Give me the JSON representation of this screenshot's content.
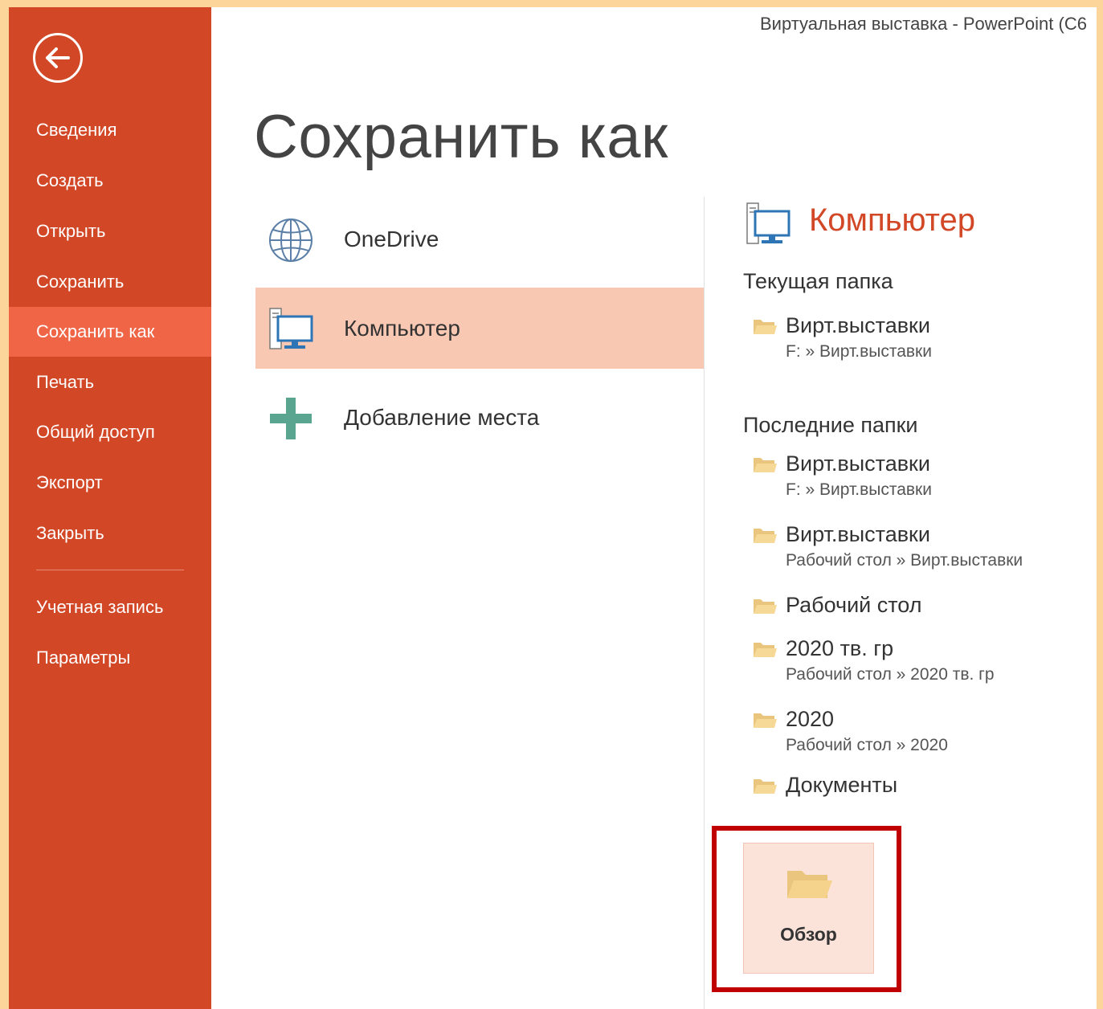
{
  "window_title": "Виртуальная выставка - PowerPoint (C6",
  "nav": {
    "back_icon": "back-arrow-icon",
    "items": [
      {
        "label": "Сведения"
      },
      {
        "label": "Создать"
      },
      {
        "label": "Открыть"
      },
      {
        "label": "Сохранить"
      },
      {
        "label": "Сохранить как",
        "active": true
      },
      {
        "label": "Печать"
      },
      {
        "label": "Общий доступ"
      },
      {
        "label": "Экспорт"
      },
      {
        "label": "Закрыть"
      },
      {
        "label": "Учетная запись"
      },
      {
        "label": "Параметры"
      }
    ]
  },
  "page_title": "Сохранить как",
  "locations": [
    {
      "label": "OneDrive",
      "icon": "globe-icon"
    },
    {
      "label": "Компьютер",
      "icon": "computer-icon",
      "active": true
    },
    {
      "label": "Добавление места",
      "icon": "plus-icon"
    }
  ],
  "right": {
    "heading": "Компьютер",
    "heading_icon": "computer-icon",
    "current_title": "Текущая папка",
    "current": [
      {
        "name": "Вирт.выставки",
        "path": "F: » Вирт.выставки"
      }
    ],
    "recent_title": "Последние папки",
    "recent": [
      {
        "name": "Вирт.выставки",
        "path": "F: » Вирт.выставки"
      },
      {
        "name": "Вирт.выставки",
        "path": "Рабочий стол » Вирт.выставки"
      },
      {
        "name": "Рабочий стол",
        "path": ""
      },
      {
        "name": "2020 тв. гр",
        "path": "Рабочий стол » 2020 тв. гр"
      },
      {
        "name": "2020",
        "path": "Рабочий стол » 2020"
      },
      {
        "name": "Документы",
        "path": ""
      }
    ],
    "browse_label": "Обзор",
    "browse_icon": "folder-open-icon"
  },
  "colors": {
    "accent": "#d24726",
    "nav_active": "#ef6545",
    "location_active": "#f8c8b3",
    "highlight_box": "#c00000",
    "outer_background": "#fbd59a"
  }
}
